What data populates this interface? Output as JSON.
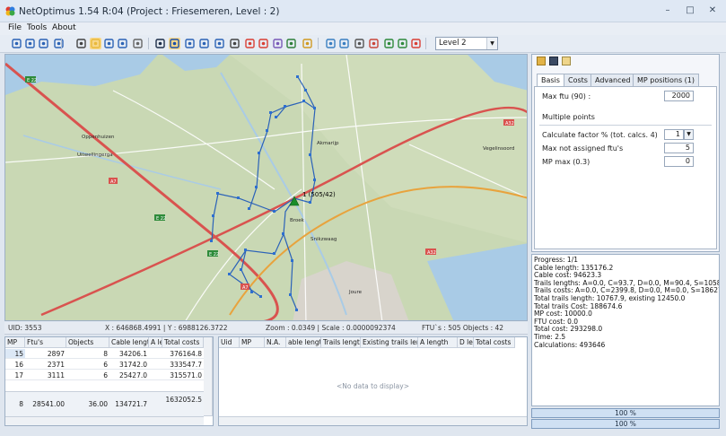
{
  "window": {
    "title": "NetOptimus 1.54 R:04 (Project : Friesemeren, Level : 2)",
    "controls": [
      "–",
      "□",
      "✕"
    ]
  },
  "menu": [
    "File",
    "Tools",
    "About"
  ],
  "toolbar": {
    "level_value": "Level 2",
    "icons": [
      "select-icon",
      "select-add-icon",
      "select-remove-icon",
      "help-icon",
      "pan-icon",
      "zoom-window-icon",
      "zoom-in-icon",
      "zoom-out-icon",
      "hand-icon",
      "save-icon",
      "info-icon",
      "route-icon",
      "refresh-icon",
      "path-icon",
      "network-icon",
      "delete-red-icon",
      "rectangle-icon",
      "chart-icon",
      "bar-chart-icon",
      "calc-icon",
      "cloud-icon",
      "settings-icon",
      "table-icon",
      "calendar-icon",
      "house-green-icon",
      "house-outline-icon",
      "stop-icon"
    ]
  },
  "map": {
    "places": [
      "Oppenhuizen",
      "Uitwellingerga",
      "Akmarijp",
      "Vegelinsoord",
      "Joure",
      "Snikzwaag",
      "Broek"
    ],
    "roads": [
      "A7",
      "A32",
      "E22",
      "A7",
      "E22",
      "A7",
      "A32"
    ],
    "marker_label": "1 (505/42)"
  },
  "status": {
    "uid": "UID: 3553",
    "coords": "X : 646868.4991 | Y : 6988126.3722",
    "zoom": "Zoom : 0.0349 | Scale : 0.0000092374",
    "counts": "FTU`s : 505  Objects : 42"
  },
  "grid_left": {
    "headers": [
      "MP",
      "Ftu's",
      "Objects",
      "Cable length",
      "A le",
      "Total costs"
    ],
    "rows": [
      [
        "15",
        "2897",
        "8",
        "34206.1",
        "",
        "376164.8"
      ],
      [
        "16",
        "2371",
        "6",
        "31742.0",
        "",
        "333547.7"
      ],
      [
        "17",
        "3111",
        "6",
        "25427.0",
        "",
        "315571.0"
      ]
    ],
    "totals": [
      "8",
      "28541.00",
      "36.00",
      "134721.7",
      "",
      "1632052.5"
    ]
  },
  "grid_right": {
    "headers": [
      "Uid",
      "MP",
      "N.A.",
      "able length",
      "Trails length",
      "Existing trails leng",
      "A length",
      "D ler",
      "Total costs"
    ],
    "empty_text": "<No data to display>"
  },
  "right_panel": {
    "header_icons": [
      "open-folder-icon",
      "save-icon",
      "edit-icon"
    ],
    "tabs": [
      "Basis",
      "Costs",
      "Advanced",
      "MP positions (1)"
    ],
    "max_ftu_label": "Max ftu (90) :",
    "max_ftu_value": "2000",
    "multiple_points": "Multiple points",
    "calc_factor_label": "Calculate factor % (tot. calcs. 4)",
    "calc_factor_value": "1",
    "max_not_assigned_label": "Max not assigned ftu's",
    "max_not_assigned_value": "5",
    "mp_max_label": "MP max (0.3)",
    "mp_max_value": "0"
  },
  "log": [
    "Progress: 1/1",
    "Cable length: 135176.2",
    "Cable cost: 94623.3",
    "Trails lengths: A=0.0, C=93.7, D=0.0, M=90.4, S=10583",
    "Trails costs: A=0.0, C=2399.8, D=0.0, M=0.0, S=186274",
    "Total trails length: 10767.9, existing 12450.0",
    "Total trails Cost: 188674.6",
    "MP cost: 10000.0",
    "FTU cost: 0.0",
    "Total cost: 293298.0",
    "Time: 2.5",
    "Calculations: 493646"
  ],
  "progress": [
    {
      "text": "100 %",
      "value": 1.0
    },
    {
      "text": "100 %",
      "value": 1.0
    }
  ],
  "colors": {
    "route": "#2b62b8",
    "node": "#2d6fd0",
    "marker": "#1a8c2a",
    "road_motorway": "#d9534f",
    "water": "#a9cbe6"
  }
}
